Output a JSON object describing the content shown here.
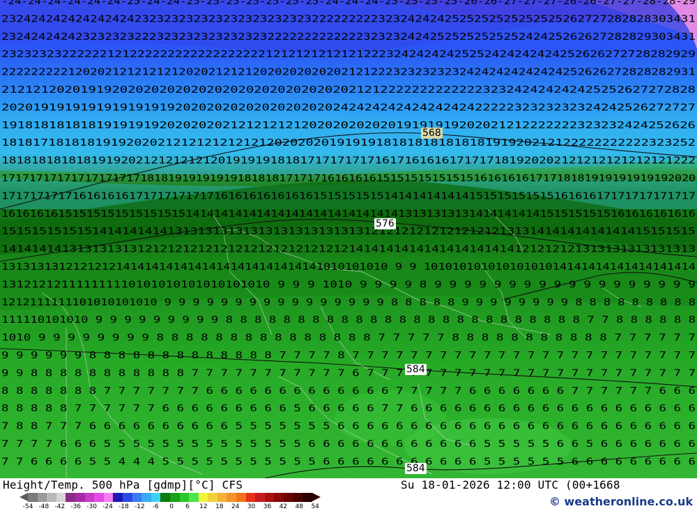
{
  "map": {
    "contour_labels": [
      {
        "id": "568",
        "text": "568",
        "style": "tan"
      },
      {
        "id": "576",
        "text": "576",
        "style": "white"
      },
      {
        "id": "584a",
        "text": "584",
        "style": "white"
      },
      {
        "id": "584b",
        "text": "584",
        "style": "white"
      }
    ],
    "temperature_rows": [
      "-24-24-24-24-24-24-25-24-24-25-25-25-25-25-25-25-24-24-24-25-25-25-25-26-26-27-27-27-26-26-27-27-28-28-29",
      "2324242424242424242323232323232323232323232222222223232424242525252525252525262727282828303431",
      "2324242424232323232223232323232323232222222222222323232424252525252525242425262627282829303431",
      "23232323222222121222222222222222222121212121212122232424242425252424242424252626272728282929",
      "2222222221202021212121212020212121202020202020212122232323232324242424242424252626272828282931",
      "2121212020191920202020202020202020202020202021212222222222222323242424242425252627272828",
      "2020191919191919191919202020202020202020202424242424242424242222232323232324242526272727",
      "1918181818181919191920202020212121212120202020202019191919202021212222222323232424252626",
      "18181718181819192020212121212121212020202019191918181818181818191920212122222222222323252",
      "181818181818191920212121212120191919181817171717171617161616171717181920202121212121212121222",
      "1717171717171717171718181919191919181818171717161616161515151515151516161616171718181919191919192020",
      "17171717171616161617171717171716161616161616151515151514141414141415151515151516161617171717171717",
      "16161616151515151515151515141414141414141414141414141414131313131314141414141515151515161616161616",
      "15151515151514141414141313131313131313131313131312121212121212121213131414141414141415151515",
      "14141414131313131312121212121212121212121212121414141414141414141414121212121313131313131313",
      "131313131212121214141414141414141414141414141010101010 9 9 10101010101010101014141414141414141414",
      "131212121111111110101010101010101010 9 9 9 1010 9 9 9 9 8 9 9 9 9 9 9 9 9 9 9 9 9 9 9 9 9 9 9",
      "1212111111101010101010 9 9 9 9 9 9 9 9 9 9 9 9 9 9 9 9 8 8 8 8 8 9 9 9 9 9 9 9 9 8 8 8 8 8 8 8 8 8",
      "111110101010 9 9 9 9 9 9 9 9 9 8 8 8 8 8 8 8 8 8 8 8 8 8 8 8 8 8 8 8 8 8 8 8 8 8 7 7 8 8 8 8 8 8",
      "1010 9 9 9 9 9 9 9 9 8 8 8 8 8 8 8 8 8 8 8 8 8 8 8 7 7 7 7 7 8 8 8 8 8 8 8 8 8 8 8 7 7 7 7 7 7",
      "9 9 9 9 9 9 8 8 8 8 8 8 8 8 8 8 8 8 8 7 7 7 7 8 7 7 7 7 7 7 7 7 7 7 7 7 7 7 7 7 7 7 7 7 7 7 7 7",
      "9 9 8 8 8 8 8 8 8 8 8 8 8 7 7 7 7 7 7 7 7 7 7 7 6 7 7 7 7 7 7 7 7 7 7 7 7 7 7 7 7 7 7 7 7 7 7 7",
      "8 8 8 8 8 8 8 7 7 7 7 7 7 7 6 6 6 6 6 6 6 6 6 6 6 6 6 7 7 7 7 7 6 6 6 6 6 6 6 7 7 7 7 7 7 6 6 6",
      "8 8 8 8 8 7 7 7 7 7 7 6 6 6 6 6 6 6 6 6 5 6 6 6 6 6 7 7 6 6 6 6 6 6 6 6 6 6 6 6 6 6 6 6 6 6 6 6",
      "7 8 8 7 7 7 6 6 6 6 6 6 6 6 6 6 5 5 5 5 5 5 5 6 6 6 6 6 6 6 6 6 6 6 6 6 6 6 6 6 6 6 6 6 6 6 6 6",
      "7 7 7 7 6 6 6 5 5 5 5 5 5 5 5 5 5 5 5 5 5 6 6 6 6 6 6 6 6 6 6 6 6 5 5 5 5 5 6 6 5 6 6 6 6 6 6 6",
      "7 7 6 6 6 6 5 5 4 4 4 5 5 5 5 5 5 5 5 5 5 5 6 6 6 6 6 6 6 6 6 6 6 5 5 5 5 5 5 6 6 6 6 6 6 6 6 6"
    ]
  },
  "footer": {
    "title_left": "Height/Temp. 500 hPa [gdmp][°C] CFS",
    "title_right": "Su 18-01-2026 12:00 UTC (00+1668",
    "copyright": "© weatheronline.co.uk",
    "legend_ticks": [
      "-54",
      "-48",
      "-42",
      "-36",
      "-30",
      "-24",
      "-18",
      "-12",
      "-6",
      "0",
      "6",
      "12",
      "18",
      "24",
      "30",
      "36",
      "42",
      "48",
      "54"
    ],
    "legend_colors": [
      "#7a7a7a",
      "#9a9a9a",
      "#b8b8b8",
      "#d6d6d6",
      "#8a2a8a",
      "#a82aa8",
      "#c83ac8",
      "#e64ae6",
      "#f57df5",
      "#1a1ab4",
      "#2a4ae6",
      "#3a7af2",
      "#3aaaf2",
      "#3ad2f2",
      "#0f7a0f",
      "#1aa01a",
      "#2ac82a",
      "#4ae64a",
      "#f2f23a",
      "#f2d23a",
      "#f2b23a",
      "#f2922a",
      "#f2721a",
      "#e6301a",
      "#c81a1a",
      "#a81010",
      "#8a0808",
      "#6a0404",
      "#4a0202",
      "#2b0000"
    ]
  }
}
